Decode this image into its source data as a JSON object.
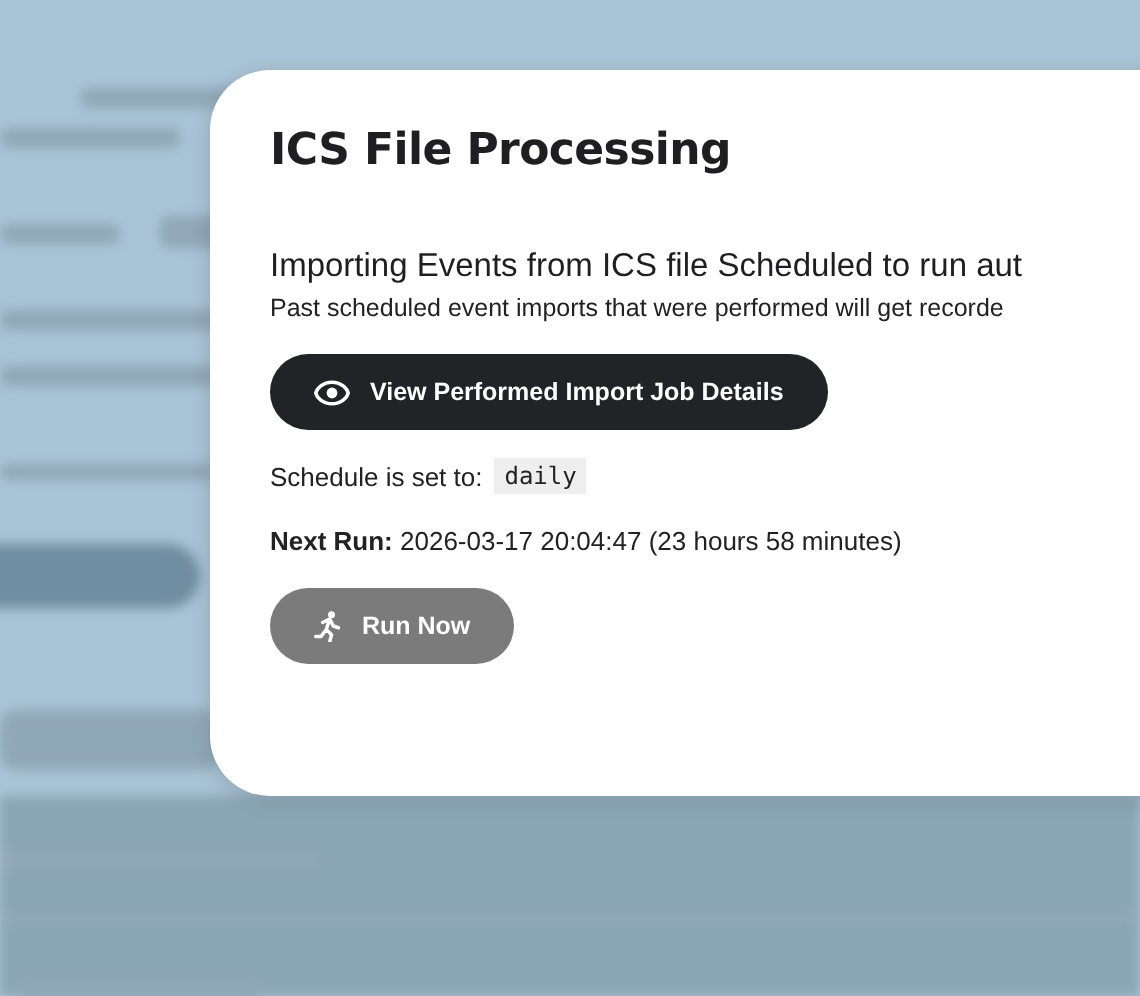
{
  "modal": {
    "title": "ICS File Processing",
    "heading": "Importing Events from ICS file Scheduled to run aut",
    "description": "Past scheduled event imports that were performed will get recorde",
    "view_button": {
      "label": "View Performed Import Job Details"
    },
    "schedule": {
      "label": "Schedule is set to:",
      "value": "daily"
    },
    "next_run": {
      "label": "Next Run:",
      "value": "2026-03-17 20:04:47 (23 hours 58 minutes)"
    },
    "run_button": {
      "label": "Run Now",
      "disabled": true
    }
  }
}
